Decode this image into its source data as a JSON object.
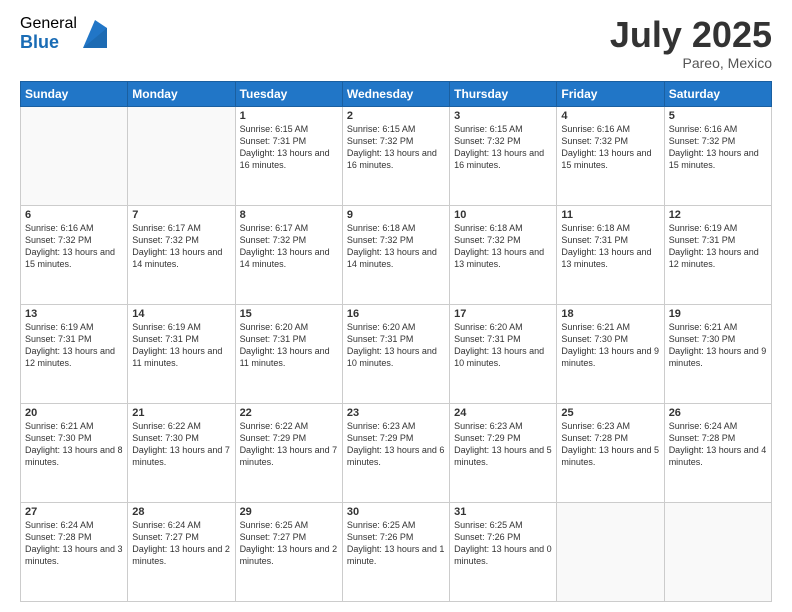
{
  "header": {
    "logo_general": "General",
    "logo_blue": "Blue",
    "month_year": "July 2025",
    "location": "Pareo, Mexico"
  },
  "weekdays": [
    "Sunday",
    "Monday",
    "Tuesday",
    "Wednesday",
    "Thursday",
    "Friday",
    "Saturday"
  ],
  "weeks": [
    [
      {
        "day": "",
        "info": ""
      },
      {
        "day": "",
        "info": ""
      },
      {
        "day": "1",
        "info": "Sunrise: 6:15 AM\nSunset: 7:31 PM\nDaylight: 13 hours\nand 16 minutes."
      },
      {
        "day": "2",
        "info": "Sunrise: 6:15 AM\nSunset: 7:32 PM\nDaylight: 13 hours\nand 16 minutes."
      },
      {
        "day": "3",
        "info": "Sunrise: 6:15 AM\nSunset: 7:32 PM\nDaylight: 13 hours\nand 16 minutes."
      },
      {
        "day": "4",
        "info": "Sunrise: 6:16 AM\nSunset: 7:32 PM\nDaylight: 13 hours\nand 15 minutes."
      },
      {
        "day": "5",
        "info": "Sunrise: 6:16 AM\nSunset: 7:32 PM\nDaylight: 13 hours\nand 15 minutes."
      }
    ],
    [
      {
        "day": "6",
        "info": "Sunrise: 6:16 AM\nSunset: 7:32 PM\nDaylight: 13 hours\nand 15 minutes."
      },
      {
        "day": "7",
        "info": "Sunrise: 6:17 AM\nSunset: 7:32 PM\nDaylight: 13 hours\nand 14 minutes."
      },
      {
        "day": "8",
        "info": "Sunrise: 6:17 AM\nSunset: 7:32 PM\nDaylight: 13 hours\nand 14 minutes."
      },
      {
        "day": "9",
        "info": "Sunrise: 6:18 AM\nSunset: 7:32 PM\nDaylight: 13 hours\nand 14 minutes."
      },
      {
        "day": "10",
        "info": "Sunrise: 6:18 AM\nSunset: 7:32 PM\nDaylight: 13 hours\nand 13 minutes."
      },
      {
        "day": "11",
        "info": "Sunrise: 6:18 AM\nSunset: 7:31 PM\nDaylight: 13 hours\nand 13 minutes."
      },
      {
        "day": "12",
        "info": "Sunrise: 6:19 AM\nSunset: 7:31 PM\nDaylight: 13 hours\nand 12 minutes."
      }
    ],
    [
      {
        "day": "13",
        "info": "Sunrise: 6:19 AM\nSunset: 7:31 PM\nDaylight: 13 hours\nand 12 minutes."
      },
      {
        "day": "14",
        "info": "Sunrise: 6:19 AM\nSunset: 7:31 PM\nDaylight: 13 hours\nand 11 minutes."
      },
      {
        "day": "15",
        "info": "Sunrise: 6:20 AM\nSunset: 7:31 PM\nDaylight: 13 hours\nand 11 minutes."
      },
      {
        "day": "16",
        "info": "Sunrise: 6:20 AM\nSunset: 7:31 PM\nDaylight: 13 hours\nand 10 minutes."
      },
      {
        "day": "17",
        "info": "Sunrise: 6:20 AM\nSunset: 7:31 PM\nDaylight: 13 hours\nand 10 minutes."
      },
      {
        "day": "18",
        "info": "Sunrise: 6:21 AM\nSunset: 7:30 PM\nDaylight: 13 hours\nand 9 minutes."
      },
      {
        "day": "19",
        "info": "Sunrise: 6:21 AM\nSunset: 7:30 PM\nDaylight: 13 hours\nand 9 minutes."
      }
    ],
    [
      {
        "day": "20",
        "info": "Sunrise: 6:21 AM\nSunset: 7:30 PM\nDaylight: 13 hours\nand 8 minutes."
      },
      {
        "day": "21",
        "info": "Sunrise: 6:22 AM\nSunset: 7:30 PM\nDaylight: 13 hours\nand 7 minutes."
      },
      {
        "day": "22",
        "info": "Sunrise: 6:22 AM\nSunset: 7:29 PM\nDaylight: 13 hours\nand 7 minutes."
      },
      {
        "day": "23",
        "info": "Sunrise: 6:23 AM\nSunset: 7:29 PM\nDaylight: 13 hours\nand 6 minutes."
      },
      {
        "day": "24",
        "info": "Sunrise: 6:23 AM\nSunset: 7:29 PM\nDaylight: 13 hours\nand 5 minutes."
      },
      {
        "day": "25",
        "info": "Sunrise: 6:23 AM\nSunset: 7:28 PM\nDaylight: 13 hours\nand 5 minutes."
      },
      {
        "day": "26",
        "info": "Sunrise: 6:24 AM\nSunset: 7:28 PM\nDaylight: 13 hours\nand 4 minutes."
      }
    ],
    [
      {
        "day": "27",
        "info": "Sunrise: 6:24 AM\nSunset: 7:28 PM\nDaylight: 13 hours\nand 3 minutes."
      },
      {
        "day": "28",
        "info": "Sunrise: 6:24 AM\nSunset: 7:27 PM\nDaylight: 13 hours\nand 2 minutes."
      },
      {
        "day": "29",
        "info": "Sunrise: 6:25 AM\nSunset: 7:27 PM\nDaylight: 13 hours\nand 2 minutes."
      },
      {
        "day": "30",
        "info": "Sunrise: 6:25 AM\nSunset: 7:26 PM\nDaylight: 13 hours\nand 1 minute."
      },
      {
        "day": "31",
        "info": "Sunrise: 6:25 AM\nSunset: 7:26 PM\nDaylight: 13 hours\nand 0 minutes."
      },
      {
        "day": "",
        "info": ""
      },
      {
        "day": "",
        "info": ""
      }
    ]
  ]
}
